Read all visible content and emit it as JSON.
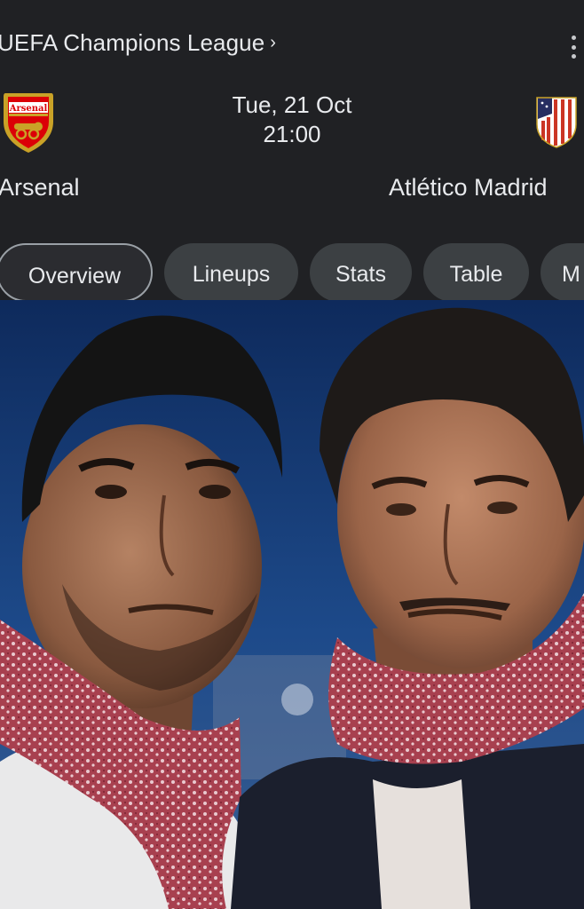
{
  "header": {
    "competition": "UEFA Champions League",
    "competition_chevron": "›",
    "more_icon": "more-vert-icon"
  },
  "match": {
    "date": "Tue, 21 Oct",
    "time": "21:00",
    "home_team": {
      "name": "Arsenal",
      "crest_text": "Arsenal",
      "crest_color": "#db0007"
    },
    "away_team": {
      "name": "Atlético Madrid",
      "crest_colors": [
        "#cb3524",
        "#272e61"
      ]
    }
  },
  "tabs": [
    {
      "label": "Overview",
      "active": true
    },
    {
      "label": "Lineups",
      "active": false
    },
    {
      "label": "Stats",
      "active": false
    },
    {
      "label": "Table",
      "active": false
    },
    {
      "label": "M",
      "active": false
    }
  ],
  "colors": {
    "background": "#202124",
    "text": "#e8eaed",
    "tab_bg": "#3c4043",
    "tab_active_border": "#9aa0a6"
  }
}
